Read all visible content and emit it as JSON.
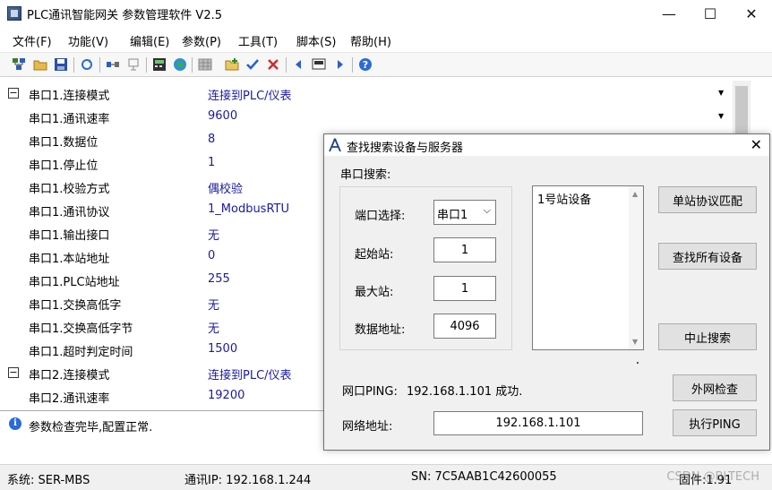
{
  "window": {
    "title": "PLC通讯智能网关 参数管理软件 V2.5",
    "minimize_glyph": "—",
    "maximize_glyph": "☐",
    "close_glyph": "✕"
  },
  "menu": [
    "文件(F)",
    "功能(V)",
    "编辑(E)",
    "参数(P)",
    "工具(T)",
    "脚本(S)",
    "帮助(H)"
  ],
  "toolbar_icons": [
    "network-icon",
    "open-folder-icon",
    "save-icon",
    "refresh-icon",
    "connect-icon",
    "disconnect-icon",
    "calculator-icon",
    "globe-icon",
    "grid-icon",
    "folder-add-icon",
    "check-icon",
    "cross-icon",
    "prev-icon",
    "screen-icon",
    "next-icon",
    "help-icon"
  ],
  "properties": [
    {
      "name": "串口1.连接模式",
      "value": "连接到PLC/仪表",
      "expander": "−",
      "dropdown": true
    },
    {
      "name": "串口1.通讯速率",
      "value": "9600",
      "dropdown": true
    },
    {
      "name": "串口1.数据位",
      "value": "8"
    },
    {
      "name": "串口1.停止位",
      "value": "1"
    },
    {
      "name": "串口1.校验方式",
      "value": "偶校验"
    },
    {
      "name": "串口1.通讯协议",
      "value": "1_ModbusRTU"
    },
    {
      "name": "串口1.输出接口",
      "value": "无"
    },
    {
      "name": "串口1.本站地址",
      "value": "0"
    },
    {
      "name": "串口1.PLC站地址",
      "value": "255"
    },
    {
      "name": "串口1.交换高低字",
      "value": "无"
    },
    {
      "name": "串口1.交换高低字节",
      "value": "无"
    },
    {
      "name": "串口1.超时判定时间",
      "value": "1500"
    },
    {
      "name": "串口2.连接模式",
      "value": "连接到PLC/仪表",
      "expander": "−"
    },
    {
      "name": "串口2.通讯速率",
      "value": "19200"
    }
  ],
  "message": {
    "icon": "i",
    "text": "参数检查完毕,配置正常."
  },
  "status": {
    "system": "系统:  SER-MBS",
    "ip": "通讯IP:  192.168.1.244",
    "sn": "SN:  7C5AAB1C42600055",
    "firmware": "固件:1.91",
    "watermark": "CSDN @BLTECH"
  },
  "dialog": {
    "title": "查找搜索设备与服务器",
    "close_glyph": "✕",
    "serial_search_label": "串口搜索:",
    "port_label": "端口选择:",
    "port_value": "串口1",
    "start_station_label": "起始站:",
    "start_station_value": "1",
    "max_station_label": "最大站:",
    "max_station_value": "1",
    "data_address_label": "数据地址:",
    "data_address_value": "4096",
    "device_list": [
      "1号站设备"
    ],
    "single_match_button": "单站协议匹配",
    "find_all_button": "查找所有设备",
    "stop_search_button": "中止搜索",
    "ping_label": "网口PING:",
    "ping_result": "192.168.1.101  成功.",
    "external_check_button": "外网检查",
    "network_address_label": "网络地址:",
    "network_address_value": "192.168.1.101",
    "execute_ping_button": "执行PING"
  }
}
